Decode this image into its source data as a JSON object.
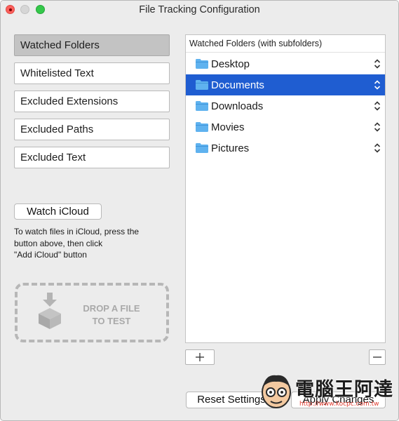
{
  "window": {
    "title": "File Tracking Configuration"
  },
  "sidebar": {
    "items": [
      {
        "label": "Watched Folders",
        "active": true
      },
      {
        "label": "Whitelisted Text",
        "active": false
      },
      {
        "label": "Excluded Extensions",
        "active": false
      },
      {
        "label": "Excluded Paths",
        "active": false
      },
      {
        "label": "Excluded Text",
        "active": false
      }
    ]
  },
  "icloud": {
    "button_label": "Watch iCloud",
    "help_lines": [
      "To watch files in iCloud, press the",
      "button above, then click",
      "\"Add iCloud\" button"
    ]
  },
  "drop_zone": {
    "lines": [
      "DROP A FILE",
      "TO TEST"
    ]
  },
  "folders": {
    "header": "Watched Folders (with subfolders)",
    "rows": [
      {
        "label": "Desktop",
        "selected": false
      },
      {
        "label": "Documents",
        "selected": true
      },
      {
        "label": "Downloads",
        "selected": false
      },
      {
        "label": "Movies",
        "selected": false
      },
      {
        "label": "Pictures",
        "selected": false
      }
    ],
    "add_icon": "plus-icon",
    "remove_icon": "minus-icon"
  },
  "footer": {
    "reset_label": "Reset Settings",
    "apply_label": "Apply Changes"
  },
  "watermark": {
    "text": "電腦王阿達",
    "url": "http://www.kocpc.com.tw"
  },
  "colors": {
    "selection": "#1f5dd1",
    "folder": "#5fb2ef",
    "close": "#fc605c",
    "maximize": "#34c84a"
  }
}
